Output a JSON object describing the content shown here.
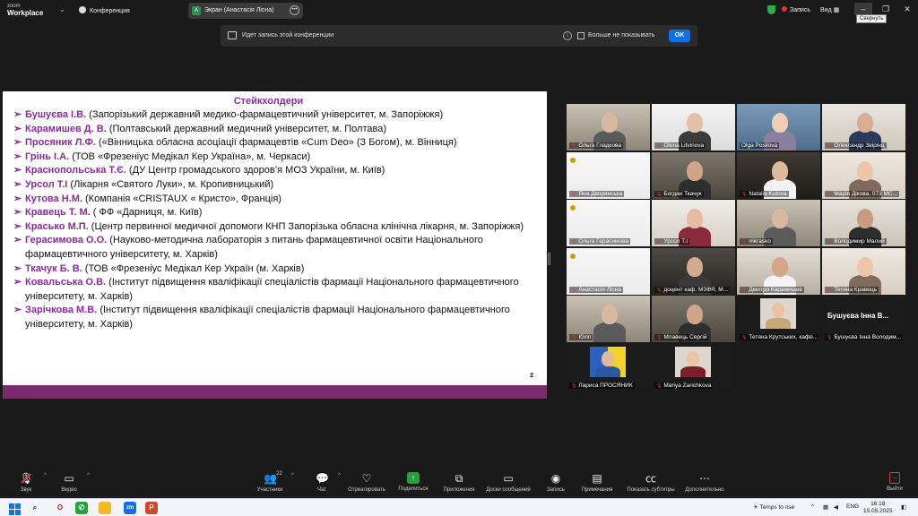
{
  "titlebar": {
    "logo_line1": "zoom",
    "logo_line2": "Workplace",
    "conference_label": "Конференция",
    "share_tab_avatar": "A",
    "share_tab_label": "Экран (Анастасія Лісна)",
    "recording_label": "Запись",
    "view_label": "Вид",
    "minimize_tooltip": "Свернуть"
  },
  "notice": {
    "text": "Идет запись этой конференции",
    "checkbox_label": "Больше не показывать",
    "ok_label": "OK"
  },
  "slide": {
    "title": "Стейкхолдери",
    "page_number": "2",
    "items": [
      {
        "name": "Бушуєва І.В.",
        "text": " (Запорізький державний медико-фармацевтичний університет, м. Запоріжжя)"
      },
      {
        "name": "Карамишев Д. В.",
        "text": " (Полтавський державний  медичний університет, м. Полтава)"
      },
      {
        "name": "Просяник Л.Ф.",
        "text": " («Вінницька обласна асоціації фармацевтів «Cum Deo» (З Богом), м. Вінниця)"
      },
      {
        "name": "Грінь І.А.",
        "text": "  (ТОВ «Фрезеніус Медікал Кер Україна», м. Черкаси)"
      },
      {
        "name": "Краснопольська Т.Є.",
        "text": " (ДУ Центр громадського здоров’я МОЗ України, м. Київ)"
      },
      {
        "name": "Урсол Т.І",
        "text": " (Лікарня «Святого Луки», м. Кропивницький)"
      },
      {
        "name": "Кутова Н.М.",
        "text": " (Компанія «CRISTAUX « Кристо», Франція)"
      },
      {
        "name": "Кравець Т. М.",
        "text": " ( ФФ «Дарниця, м. Київ)"
      },
      {
        "name": "Красько М.П.",
        "text": " (Центр первинної медичної допомоги КНП Запорізька обласна клінічна лікарня, м. Запоріжжя)"
      },
      {
        "name": "Герасимова  О.О.",
        "text": " (Науково-методична лабораторія  з питань фармацевтичної освіти Національного фармацевтичного університету, м. Харків)"
      },
      {
        "name": "Ткачук Б. В.",
        "text": "  (ТОВ «Фрезеніус Медікал Кер Україн (м. Харків)"
      },
      {
        "name": "Ковальська О.В.",
        "text": " (Інститут підвищення кваліфікації спеціалістів фармації Національного фармацевтичного університету, м. Харків)"
      },
      {
        "name": "Зарічкова М.В.",
        "text": " (Інститут підвищення кваліфікації спеціалістів фармації Національного фармацевтичного університету, м. Харків)"
      }
    ]
  },
  "gallery": {
    "participants": [
      {
        "name": "Ольга Гладкова",
        "muted": true,
        "scene": "office"
      },
      {
        "name": "Olena Litvinova",
        "muted": true,
        "scene": "headset"
      },
      {
        "name": "Olga Posilova",
        "muted": false,
        "scene": "blonde",
        "active": true
      },
      {
        "name": "Олександр Звірінц",
        "muted": true,
        "scene": "man-light"
      },
      {
        "name": "Яна Дворянська",
        "muted": true,
        "scene": "logo"
      },
      {
        "name": "Богдан Ткачук",
        "muted": true,
        "scene": "man-dark"
      },
      {
        "name": "Natalia Kutova",
        "muted": true,
        "scene": "woman-dark"
      },
      {
        "name": "Марія Дікова, 073 МС...",
        "muted": true,
        "scene": "woman-light"
      },
      {
        "name": "Ольга Герасимова",
        "muted": true,
        "scene": "logo"
      },
      {
        "name": "Урсол Т.І",
        "muted": true,
        "scene": "woman-red"
      },
      {
        "name": "mkrasko",
        "muted": true,
        "scene": "office"
      },
      {
        "name": "Володимир Малий",
        "muted": true,
        "scene": "man-beard"
      },
      {
        "name": "Анастасія Лісна",
        "muted": true,
        "scene": "logo"
      },
      {
        "name": "доцент каф. МЗФЯ, М...",
        "muted": true,
        "scene": "man-glasses"
      },
      {
        "name": "Дмитро Карамишев",
        "muted": true,
        "scene": "man-shirt"
      },
      {
        "name": "Тетяна Кравець",
        "muted": true,
        "scene": "woman-light"
      },
      {
        "name": "IGrin",
        "muted": true,
        "scene": "office"
      },
      {
        "name": "Млавець Сергій",
        "muted": true,
        "scene": "man-dark"
      },
      {
        "name": "Тетяна Крутських, кафе...",
        "muted": true,
        "scene": "portrait"
      },
      {
        "name": "Бушуєва Інна Володим...",
        "muted": true,
        "scene": "text",
        "big_name": "Бушуєва Інна В..."
      },
      {
        "name": "Лариса ПРОСЯНИК",
        "muted": true,
        "scene": "flag"
      },
      {
        "name": "Mariya Zarichkova",
        "muted": true,
        "scene": "portrait2"
      }
    ]
  },
  "toolbar": {
    "audio": "Звук",
    "video": "Видео",
    "participants": "Участники",
    "participants_count": "22",
    "chat": "Чат",
    "reactions": "Отреагировать",
    "share": "Поделиться",
    "apps": "Приложения",
    "whiteboards": "Доски сообщений",
    "record": "Запись",
    "notes": "Примечания",
    "captions": "Показать субтитры",
    "more": "Дополнительно",
    "exit": "Выйти"
  },
  "taskbar": {
    "weather": "Temps to rise",
    "lang": "ENG",
    "time": "16:18",
    "date": "15.05.2025"
  },
  "colors": {
    "accent_purple": "#8b2aa0",
    "slide_bar": "#7a2a6f",
    "active_speaker": "#3ad45b",
    "zoom_blue": "#0e71eb",
    "share_green": "#22a33a",
    "mute_red": "#e23a36"
  }
}
